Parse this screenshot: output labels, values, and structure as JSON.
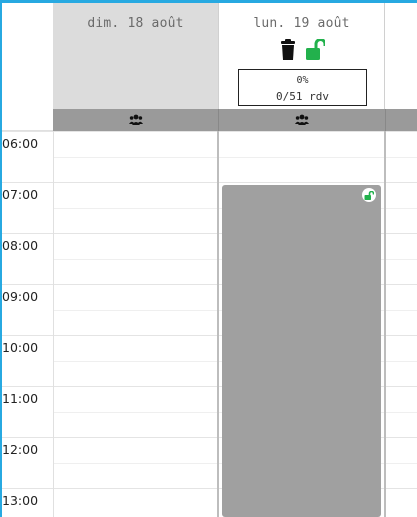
{
  "days": [
    {
      "title": "dim. 18 août"
    },
    {
      "title": "lun. 19 août",
      "stats": {
        "percent": "0%",
        "rdv": "0/51 rdv"
      }
    }
  ],
  "hours": [
    "06:00",
    "07:00",
    "08:00",
    "09:00",
    "10:00",
    "11:00",
    "12:00",
    "13:00"
  ],
  "icons": {
    "trash": "trash-icon",
    "unlock": "unlock-icon",
    "group": "users-icon"
  },
  "colors": {
    "accent": "#27a9e1",
    "unlock_green": "#22b14c",
    "closed_day": "#dcdcdc",
    "slot_block": "#a0a0a0",
    "group_bar": "#9a9a9a"
  }
}
